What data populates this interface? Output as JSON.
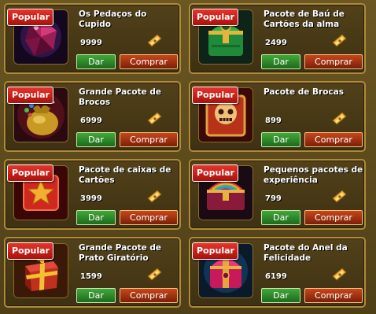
{
  "shop": {
    "items": [
      {
        "badge": "Popular",
        "name": "Os Pedaços do Cupido",
        "price": "9999",
        "give_label": "Dar",
        "buy_label": "Comprar",
        "icon": "red-gem-icon"
      },
      {
        "badge": "Popular",
        "name": "Pacote de Baú de Cartões da alma",
        "price": "2499",
        "give_label": "Dar",
        "buy_label": "Comprar",
        "icon": "green-chest-icon"
      },
      {
        "badge": "Popular",
        "name": "Grande Pacote de Brocos",
        "price": "6999",
        "give_label": "Dar",
        "buy_label": "Comprar",
        "icon": "gold-sack-icon"
      },
      {
        "badge": "Popular",
        "name": "Pacote de Brocas",
        "price": "899",
        "give_label": "Dar",
        "buy_label": "Comprar",
        "icon": "skull-crate-icon"
      },
      {
        "badge": "Popular",
        "name": "Pacote de caixas de Cartões",
        "price": "3999",
        "give_label": "Dar",
        "buy_label": "Comprar",
        "icon": "star-card-box-icon"
      },
      {
        "badge": "Popular",
        "name": "Pequenos pacotes de experiência",
        "price": "799",
        "give_label": "Dar",
        "buy_label": "Comprar",
        "icon": "rainbow-chest-icon"
      },
      {
        "badge": "Popular",
        "name": "Grande Pacote de Prato Giratório",
        "price": "1599",
        "give_label": "Dar",
        "buy_label": "Comprar",
        "icon": "gift-box-icon"
      },
      {
        "badge": "Popular",
        "name": "Pacote do Anel da Felicidade",
        "price": "6199",
        "give_label": "Dar",
        "buy_label": "Comprar",
        "icon": "pink-chest-icon"
      }
    ]
  },
  "colors": {
    "badge_red": "#d9241c",
    "give_green": "#2e8a2a",
    "buy_red": "#a4300f",
    "card_border": "#b08a3b",
    "card_bg": "#4a3a16"
  }
}
